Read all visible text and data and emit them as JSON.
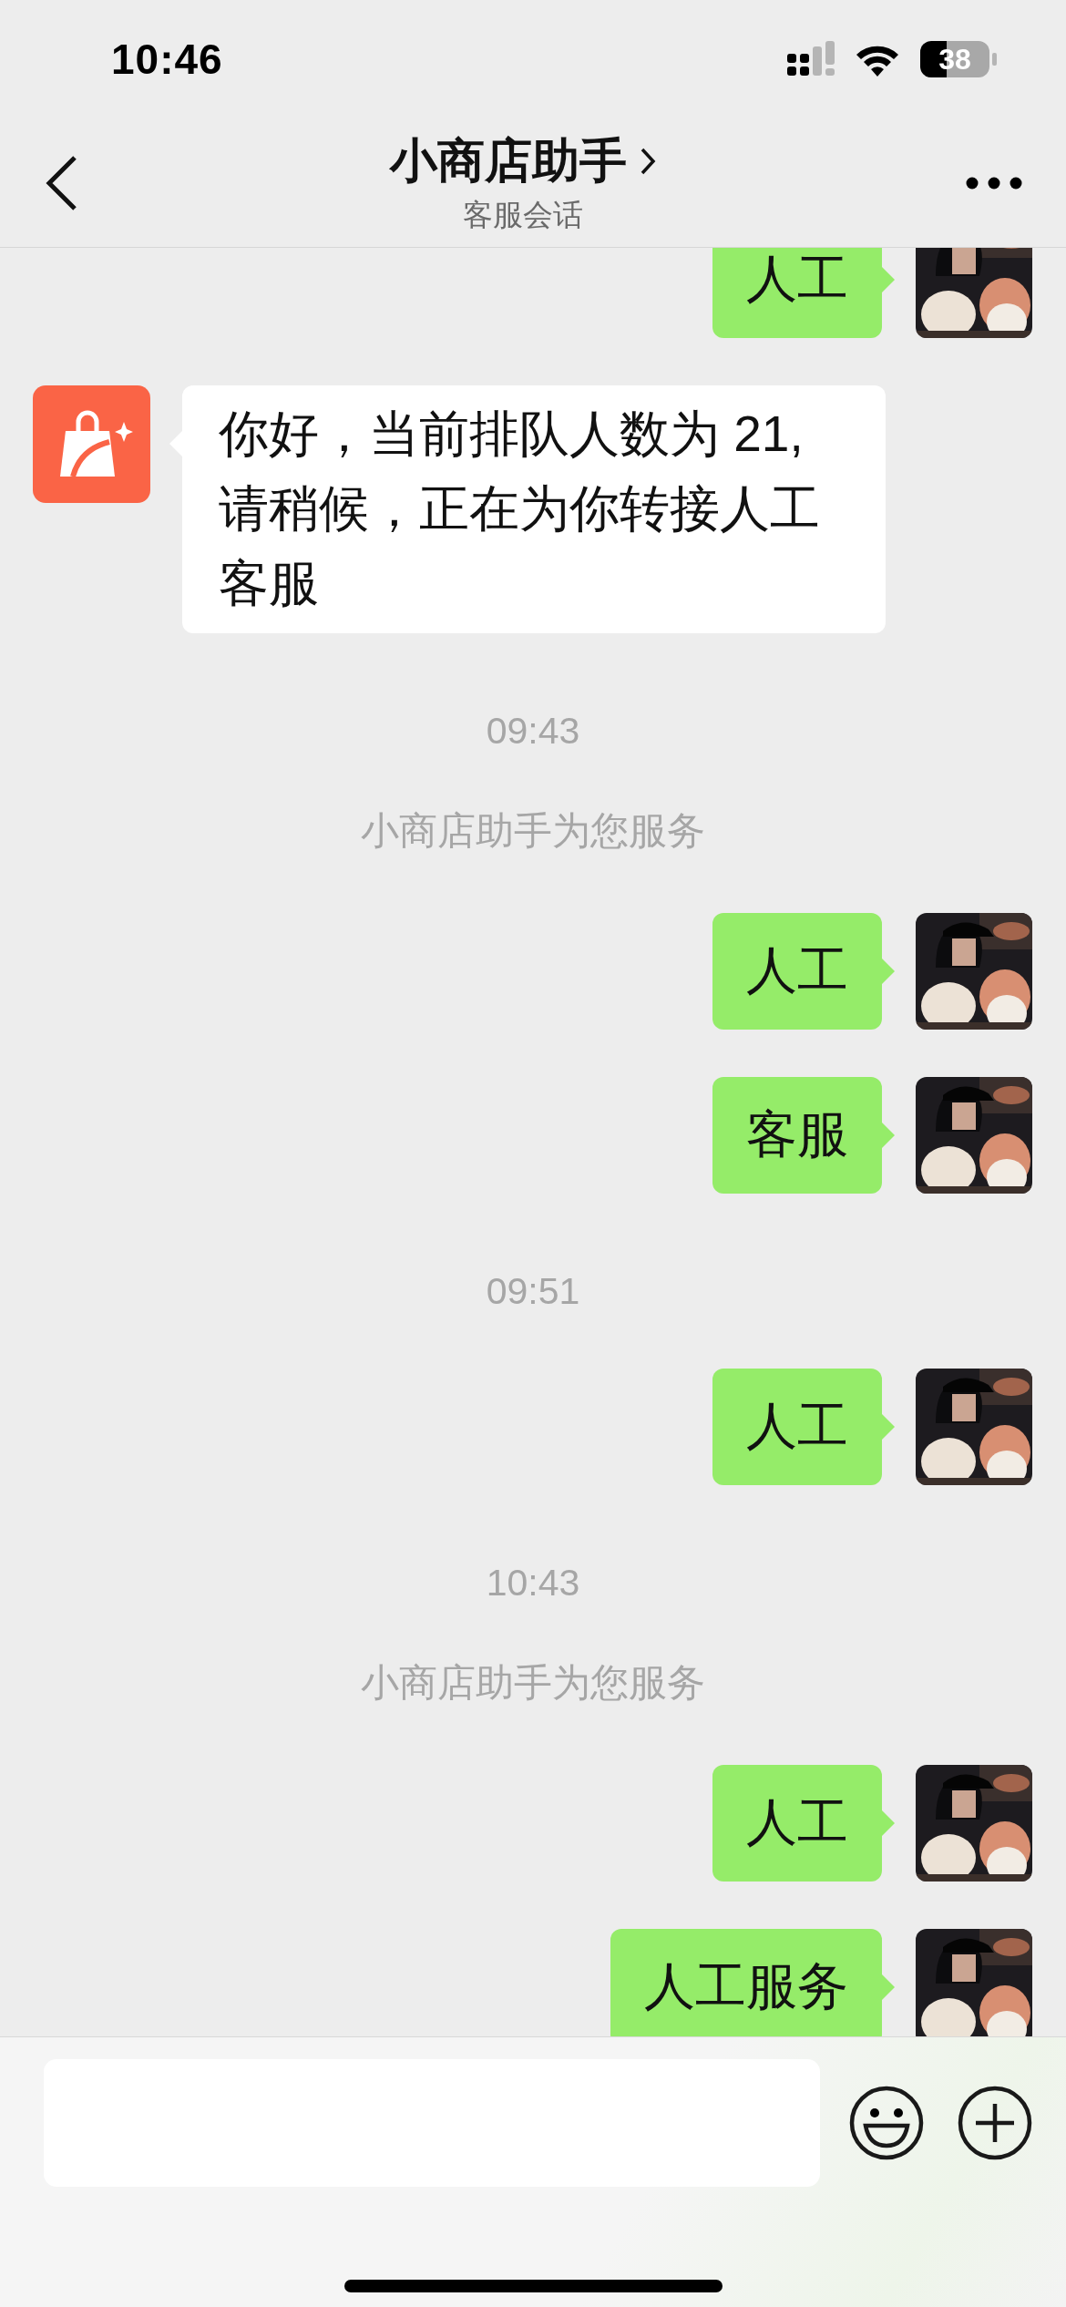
{
  "status_bar": {
    "time": "10:46",
    "battery": "38"
  },
  "header": {
    "title": "小商店助手",
    "subtitle": "客服会话"
  },
  "messages": [
    {
      "kind": "outgoing",
      "text": "人工"
    },
    {
      "kind": "incoming",
      "text": "你好，当前排队人数为 21,请稍候，正在为你转接人工客服"
    },
    {
      "kind": "time",
      "text": "09:43"
    },
    {
      "kind": "notice",
      "text": "小商店助手为您服务"
    },
    {
      "kind": "outgoing",
      "text": "人工"
    },
    {
      "kind": "outgoing",
      "text": "客服"
    },
    {
      "kind": "time",
      "text": "09:51"
    },
    {
      "kind": "outgoing",
      "text": "人工"
    },
    {
      "kind": "time",
      "text": "10:43"
    },
    {
      "kind": "notice",
      "text": "小商店助手为您服务"
    },
    {
      "kind": "outgoing",
      "text": "人工"
    },
    {
      "kind": "outgoing",
      "text": "人工服务"
    }
  ]
}
